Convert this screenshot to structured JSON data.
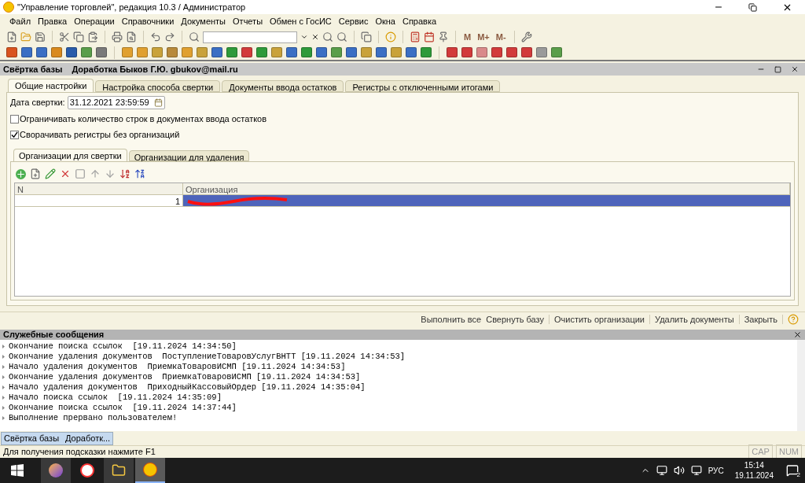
{
  "window": {
    "title": "\"Управление торговлей\", редакция 10.3 / Администратор"
  },
  "menu": [
    "Файл",
    "Правка",
    "Операции",
    "Справочники",
    "Документы",
    "Отчеты",
    "Обмен с ГосИС",
    "Сервис",
    "Окна",
    "Справка"
  ],
  "toolbar": {
    "memory_buttons": [
      "M",
      "M+",
      "M-"
    ]
  },
  "document": {
    "title": "Свёртка базы",
    "subtitle": "Доработка Быков Г.Ю. gbukov@mail.ru",
    "tabs": [
      {
        "label": "Общие настройки",
        "selected": true
      },
      {
        "label": "Настройка способа свертки",
        "selected": false
      },
      {
        "label": "Документы ввода остатков",
        "selected": false
      },
      {
        "label": "Регистры с отключенными итогами",
        "selected": false
      }
    ],
    "date_label": "Дата свертки:",
    "date_value": "31.12.2021 23:59:59",
    "checkboxes": [
      {
        "label": "Ограничивать количество строк в документах ввода остатков",
        "checked": false
      },
      {
        "label": "Сворачивать регистры без организаций",
        "checked": true
      }
    ],
    "inner_tabs": [
      {
        "label": "Организации для свертки",
        "selected": true
      },
      {
        "label": "Организации для удаления",
        "selected": false
      }
    ],
    "table": {
      "columns": [
        "N",
        "Организация"
      ],
      "rows": [
        {
          "n": "1",
          "redacted": true,
          "selected": true
        }
      ]
    },
    "commands": [
      "Выполнить все",
      "Свернуть базу",
      "Очистить организации",
      "Удалить документы",
      "Закрыть"
    ]
  },
  "messages": {
    "title": "Служебные сообщения",
    "lines": [
      "Окончание поиска ссылок  [19.11.2024 14:34:50]",
      "Окончание удаления документов  ПоступлениеТоваровУслугВНТТ [19.11.2024 14:34:53]",
      "Начало удаления документов  ПриемкаТоваровИСМП [19.11.2024 14:34:53]",
      "Окончание удаления документов  ПриемкаТоваровИСМП [19.11.2024 14:34:53]",
      "Начало удаления документов  ПриходныйКассовыйОрдер [19.11.2024 14:35:04]",
      "Начало поиска ссылок  [19.11.2024 14:35:09]",
      "Окончание поиска ссылок  [19.11.2024 14:37:44]",
      "Выполнение прервано пользователем!"
    ]
  },
  "window_bar": [
    {
      "title": "Свёртка базы",
      "subtitle": "Доработк...",
      "selected": true
    }
  ],
  "status_bar": {
    "hint": "Для получения подсказки нажмите F1",
    "indicators": [
      "CAP",
      "NUM"
    ]
  },
  "taskbar": {
    "language": "РУС",
    "time": "15:14",
    "date": "19.11.2024",
    "notifications": "2"
  }
}
